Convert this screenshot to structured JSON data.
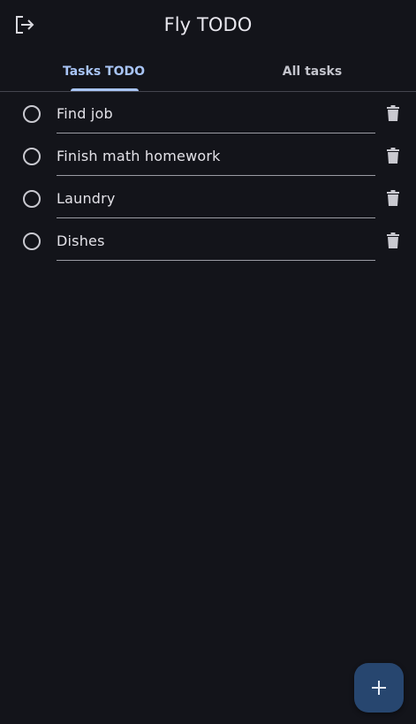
{
  "app": {
    "title": "Fly TODO"
  },
  "tabs": [
    {
      "label": "Tasks TODO",
      "selected": true
    },
    {
      "label": "All tasks",
      "selected": false
    }
  ],
  "tasks": [
    {
      "title": "Find job",
      "completed": false
    },
    {
      "title": "Finish math homework",
      "completed": false
    },
    {
      "title": "Laundry",
      "completed": false
    },
    {
      "title": "Dishes",
      "completed": false
    }
  ],
  "icons": {
    "logout": "logout-icon",
    "checkbox": "radio-unchecked-icon",
    "delete": "trash-icon",
    "add": "plus-icon"
  },
  "colors": {
    "background": "#13141a",
    "accent": "#a8c4f5",
    "fab": "#27466f"
  }
}
